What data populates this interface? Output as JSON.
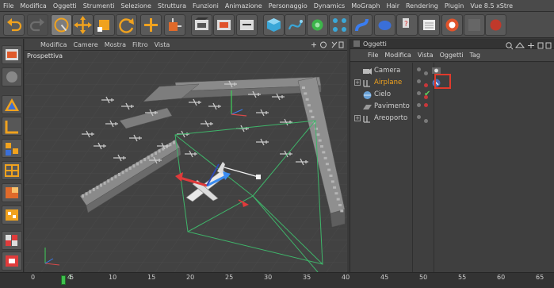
{
  "menubar": {
    "items": [
      "File",
      "Modifica",
      "Oggetti",
      "Strumenti",
      "Selezione",
      "Struttura",
      "Funzioni",
      "Animazione",
      "Personaggio",
      "Dynamics",
      "MoGraph",
      "Hair",
      "Rendering",
      "Plugin",
      "Vue 8.5 xStre"
    ]
  },
  "toolbar": {
    "buttons": [
      "undo-icon",
      "redo-icon",
      "live-selection-icon",
      "move-icon",
      "scale-icon",
      "rotate-icon",
      "xyz-axis-icon",
      "object-coordinates-icon",
      "render-view-icon",
      "render-picture-viewer-icon",
      "edit-render-settings-icon",
      "cube-primitive-icon",
      "spline-icon",
      "nurbs-icon",
      "array-icon",
      "deformer-icon",
      "scene-icon",
      "camera-icon",
      "light-icon",
      "help-icon",
      "layout-icon",
      "vue-icon"
    ]
  },
  "left_tools": [
    "polygon-mode-icon",
    "texture-mode-icon",
    "axis-mode-icon",
    "points-mode-icon",
    "edges-mode-icon",
    "polygons-mode-icon",
    "model-mode-icon",
    "object-mode-icon",
    "workplane-icon",
    "snapping-icon",
    "grid-icon",
    "render-region-icon"
  ],
  "viewport": {
    "menu": [
      "Modifica",
      "Camere",
      "Mostra",
      "Filtro",
      "Vista"
    ],
    "label": "Prospettiva"
  },
  "objects_panel": {
    "title": "Oggetti",
    "menu": [
      "File",
      "Modifica",
      "Vista",
      "Oggetti",
      "Tag"
    ],
    "rows": [
      {
        "name": "Camera",
        "active": false,
        "has_children": false,
        "icon": "camera-icon",
        "tag": "camera-target-tag-icon",
        "check": false
      },
      {
        "name": "Airplane",
        "active": true,
        "has_children": true,
        "icon": "null-object-icon",
        "tag": "vue-tag-icon",
        "check": false
      },
      {
        "name": "Cielo",
        "active": false,
        "has_children": false,
        "icon": "sky-icon",
        "tag": "",
        "check": true
      },
      {
        "name": "Pavimento",
        "active": false,
        "has_children": false,
        "icon": "floor-icon",
        "tag": "",
        "check": false
      },
      {
        "name": "Areoporto",
        "active": false,
        "has_children": true,
        "icon": "null-object-icon",
        "tag": "",
        "check": false
      }
    ]
  },
  "timeline": {
    "ticks": [
      "0",
      "5",
      "10",
      "15",
      "20",
      "25",
      "30",
      "35",
      "40",
      "45",
      "50",
      "55",
      "60",
      "65"
    ],
    "current_frame": "4"
  },
  "colors": {
    "active_object": "#f0a21e",
    "highlight_box": "#e03a2c",
    "camera_frustum": "#3fb56a",
    "playhead": "#3fbf4c"
  }
}
